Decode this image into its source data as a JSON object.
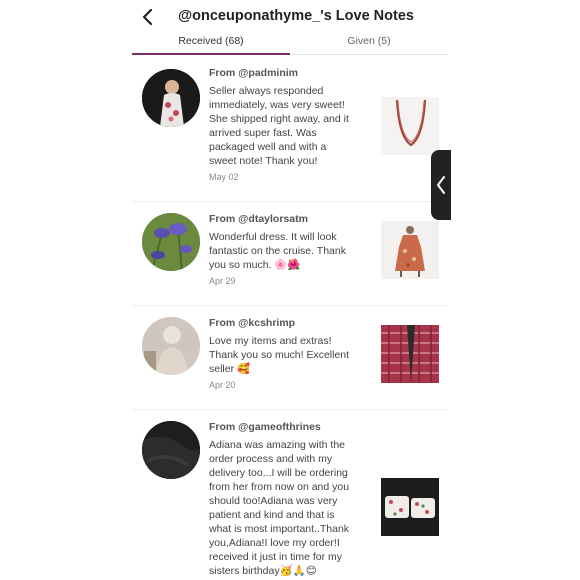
{
  "header": {
    "title": "@onceuponathyme_'s Love Notes"
  },
  "tabs": [
    {
      "label": "Received (68)",
      "active": true
    },
    {
      "label": "Given (5)",
      "active": false
    }
  ],
  "notes": [
    {
      "from": "From @padminim",
      "lines": [
        "Seller always responded",
        "immediately, was very sweet!",
        "She shipped right away, and it",
        "arrived super fast. Was",
        "packaged well and with a",
        "sweet note! Thank you!"
      ],
      "date": "May 02",
      "item": "red necklace"
    },
    {
      "from": "From @dtaylorsatm",
      "lines": [
        "Wonderful dress. It will look",
        "fantastic on the cruise. Thank",
        "you so much. 🌸🌺"
      ],
      "date": "Apr 29",
      "item": "floral dress"
    },
    {
      "from": "From @kcshrimp",
      "lines": [
        "Love my items and extras!",
        "Thank you so much! Excellent",
        "seller 🥰"
      ],
      "date": "Apr 20",
      "item": "plaid cardigan"
    },
    {
      "from": "From @gameofthrines",
      "lines": [
        "Adiana was amazing with the",
        "order process and with my",
        "delivery too...I will be ordering",
        "from her from now on and you",
        "should too!Adiana was very",
        "patient and kind and that is",
        "what is most important..Thank",
        "you,Adiana!I love my order!I",
        "received it just in time for my",
        "sisters birthday🥳🙏😊"
      ],
      "date": "",
      "item": "floral pouches"
    }
  ],
  "colors": {
    "accent": "#7a2d6e",
    "drawer": "#222222"
  }
}
